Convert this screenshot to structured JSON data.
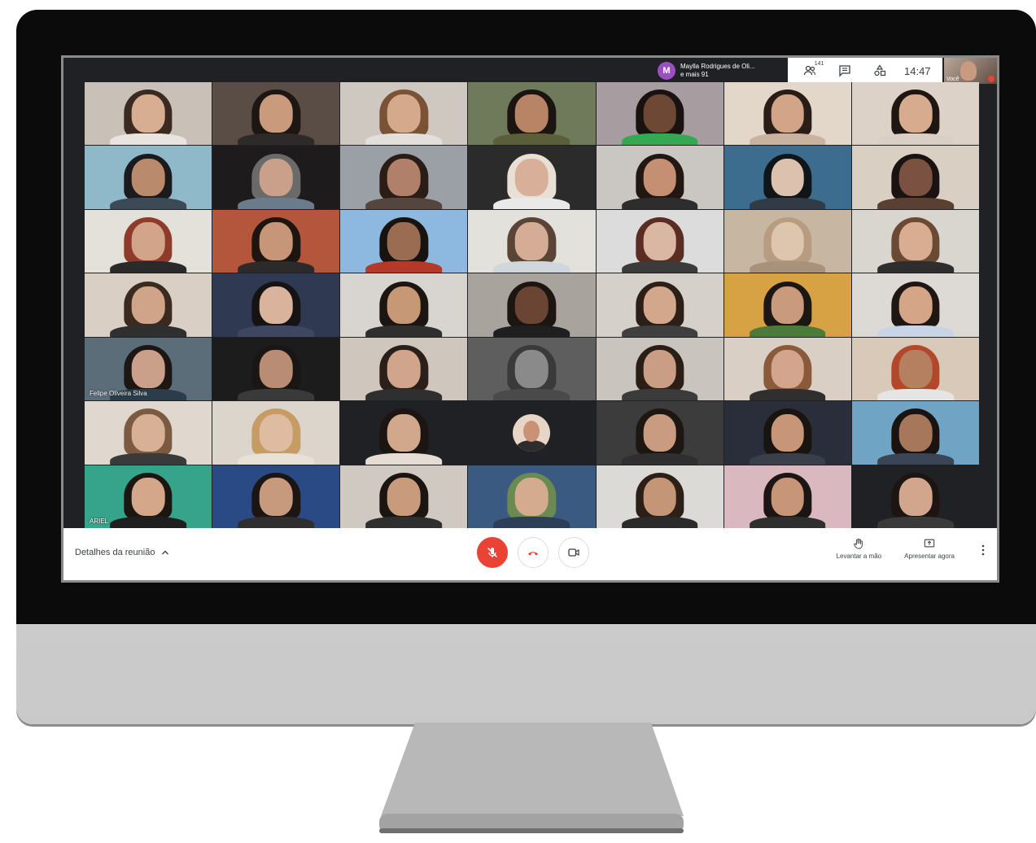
{
  "topbar": {
    "presenter_initial": "M",
    "presenter_name": "Maylla Rodrigues de Oli...",
    "presenter_more": "e mais 91",
    "participants_count": "141",
    "time": "14:47",
    "self_label": "Você"
  },
  "tiles": [
    {
      "bg": "#c9c1b8",
      "skin": "#d7ae92",
      "hair": "#3a2a20",
      "shirt": "#e9e4df"
    },
    {
      "bg": "#5a4d46",
      "skin": "#c99a7b",
      "hair": "#1e1612",
      "shirt": "#2f2a2a"
    },
    {
      "bg": "#cfc8c0",
      "skin": "#d4a98c",
      "hair": "#7a5235",
      "shirt": "#e3dfda"
    },
    {
      "bg": "#6e7a5a",
      "skin": "#b78565",
      "hair": "#1b1411",
      "shirt": "#5a5e3a"
    },
    {
      "bg": "#a79ca0",
      "skin": "#6d4834",
      "hair": "#1a1210",
      "shirt": "#34a853"
    },
    {
      "bg": "#e3d7ca",
      "skin": "#d3a588",
      "hair": "#2a1d18",
      "shirt": "#c9b2a0"
    },
    {
      "bg": "#ddd2c7",
      "skin": "#d6ab8e",
      "hair": "#1f1512",
      "shirt": "#d9cfc4"
    },
    {
      "bg": "#8fb9c9",
      "skin": "#b98a6c",
      "hair": "#1b1a1c",
      "shirt": "#3b4a55"
    },
    {
      "bg": "#1d1b1b",
      "skin": "#caa08a",
      "hair": "#6a6a6a",
      "shirt": "#6a7b8b"
    },
    {
      "bg": "#9aa0a6",
      "skin": "#b0806a",
      "hair": "#2a1d16",
      "shirt": "#55453f"
    },
    {
      "bg": "#2b2b2b",
      "skin": "#d8b09a",
      "hair": "#e8e0d5",
      "shirt": "#e9e9e9"
    },
    {
      "bg": "#cac6c2",
      "skin": "#c48f72",
      "hair": "#221712",
      "shirt": "#2d2d2d"
    },
    {
      "bg": "#3c6c8e",
      "skin": "#dcc1ae",
      "hair": "#10151a",
      "shirt": "#313a45"
    },
    {
      "bg": "#d9cfc3",
      "skin": "#7b5241",
      "hair": "#1a1311",
      "shirt": "#5a3f33"
    },
    {
      "bg": "#e4e0da",
      "skin": "#d2a48a",
      "hair": "#8f3b2b",
      "shirt": "#2a2a2a"
    },
    {
      "bg": "#b4563c",
      "skin": "#c79678",
      "hair": "#1e1410",
      "shirt": "#2c2a2a"
    },
    {
      "bg": "#8db9e0",
      "skin": "#9a6c52",
      "hair": "#191310",
      "shirt": "#b53829"
    },
    {
      "bg": "#e3e1dc",
      "skin": "#d5ac95",
      "hair": "#5a4435",
      "shirt": "#cfd6dc"
    },
    {
      "bg": "#dcdcdc",
      "skin": "#d9b7a2",
      "hair": "#5a2c22",
      "shirt": "#3b3b3b"
    },
    {
      "bg": "#c7b7a2",
      "skin": "#ddc6ad",
      "hair": "#b79c82",
      "shirt": "#a8927b"
    },
    {
      "bg": "#d9d5cf",
      "skin": "#d8ad92",
      "hair": "#6a4a33",
      "shirt": "#2e2e2e"
    },
    {
      "bg": "#d9cfc4",
      "skin": "#cfa488",
      "hair": "#3b2a20",
      "shirt": "#2f2f2f"
    },
    {
      "bg": "#2f3a52",
      "skin": "#d9b39b",
      "hair": "#161314",
      "shirt": "#3e4660"
    },
    {
      "bg": "#d8d4cf",
      "skin": "#c79876",
      "hair": "#1d1512",
      "shirt": "#2f2f2f"
    },
    {
      "bg": "#a9a39d",
      "skin": "#6b4533",
      "hair": "#1c1512",
      "shirt": "#1f1f1f"
    },
    {
      "bg": "#d5d0ca",
      "skin": "#d3a78c",
      "hair": "#2c1f18",
      "shirt": "#3f3f3f"
    },
    {
      "bg": "#d7a243",
      "skin": "#c99a7c",
      "hair": "#1d1714",
      "shirt": "#4b7a3a"
    },
    {
      "bg": "#dddad5",
      "skin": "#d4a586",
      "hair": "#1e1713",
      "shirt": "#c9d5e6"
    },
    {
      "bg": "#5a6d78",
      "skin": "#cba08a",
      "hair": "#1c1715",
      "shirt": "#2b3d4a",
      "label": "Felipe Oliveira Silva"
    },
    {
      "bg": "#1c1c1c",
      "skin": "#b98c74",
      "hair": "#1a1615",
      "shirt": "#3a3a3a"
    },
    {
      "bg": "#cfc6bd",
      "skin": "#d0a58b",
      "hair": "#2a1f19",
      "shirt": "#2f2f2f"
    },
    {
      "bg": "#5e5e5e",
      "skin": "#8a8a8a",
      "hair": "#3a3a3a",
      "shirt": "#4a4a4a"
    },
    {
      "bg": "#c9c4bd",
      "skin": "#c99e84",
      "hair": "#2b1e17",
      "shirt": "#3b3b3b"
    },
    {
      "bg": "#d9cfc4",
      "skin": "#d4a58d",
      "hair": "#8a5a3a",
      "shirt": "#2f2f2f"
    },
    {
      "bg": "#d9c9b8",
      "skin": "#b5805f",
      "hair": "#b3472b",
      "shirt": "#e5e5e5"
    },
    {
      "bg": "#e0d8cf",
      "skin": "#d8b095",
      "hair": "#7a5a40",
      "shirt": "#3a3a3a"
    },
    {
      "bg": "#dcd5cc",
      "skin": "#ddbca2",
      "hair": "#c69b64",
      "shirt": "#e7e1d8"
    },
    {
      "bg": "#202124",
      "skin": "#d2a88d",
      "hair": "#1c1512",
      "shirt": "#e5ddd3"
    },
    {
      "bg": "#202124",
      "avatar": true
    },
    {
      "bg": "#3c3c3c",
      "skin": "#c99b80",
      "hair": "#1d1613",
      "shirt": "#2f2f2f"
    },
    {
      "bg": "#2a2e3a",
      "skin": "#c79679",
      "hair": "#1a1411",
      "shirt": "#3a3f4a"
    },
    {
      "bg": "#6fa4c4",
      "skin": "#a7775c",
      "hair": "#1a1311",
      "shirt": "#3a4655"
    },
    {
      "bg": "#36a48a",
      "skin": "#d4a78a",
      "hair": "#1c1613",
      "shirt": "#1f1f1f",
      "label": "ARIEL"
    },
    {
      "bg": "#2a4a86",
      "skin": "#c89a7d",
      "hair": "#1b1513",
      "shirt": "#2f2f2f"
    },
    {
      "bg": "#cfc9c2",
      "skin": "#c99b7d",
      "hair": "#1b1512",
      "shirt": "#2f2f2f"
    },
    {
      "bg": "#3a5a82",
      "skin": "#d4ab8f",
      "hair": "#6a8a52",
      "shirt": "#2c3e58"
    },
    {
      "bg": "#dcdad6",
      "skin": "#c49576",
      "hair": "#2b1f18",
      "shirt": "#2b2b2b"
    },
    {
      "bg": "#d9b8c0",
      "skin": "#c79679",
      "hair": "#1c1513",
      "shirt": "#2f2f2f"
    },
    {
      "bg": "#202124",
      "skin": "#d2a68c",
      "hair": "#1d1512",
      "shirt": "#3a3a3a"
    }
  ],
  "bottombar": {
    "details_label": "Detalhes da reunião",
    "raise_hand_label": "Levantar a mão",
    "present_label": "Apresentar agora"
  },
  "colors": {
    "mic_off_red": "#ea4335",
    "hangup_red": "#ea4335",
    "bar_text": "#3c4043"
  }
}
